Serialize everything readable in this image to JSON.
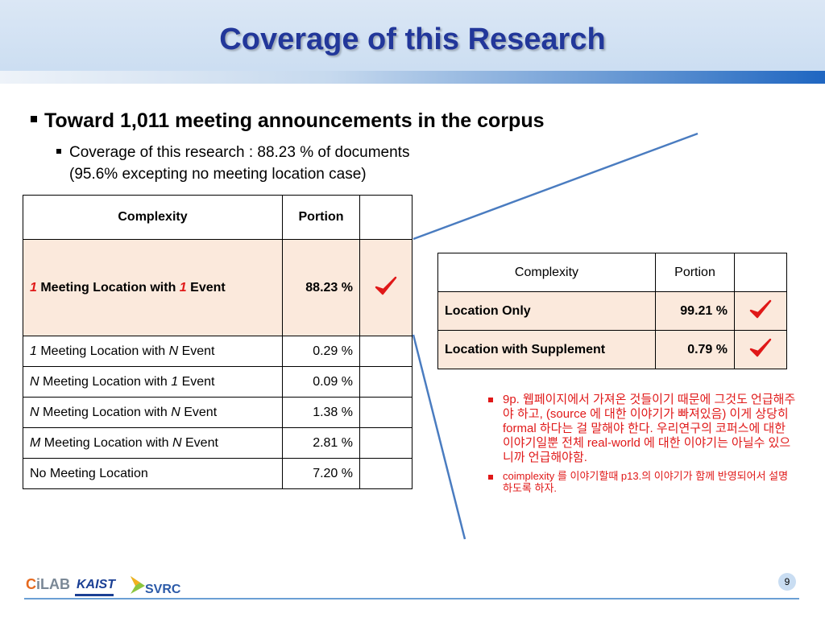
{
  "slide": {
    "title": "Coverage of this Research",
    "bullet_main": "Toward 1,011 meeting announcements in the corpus",
    "bullet_sub_line1": "Coverage of this research : 88.23 % of documents",
    "bullet_sub_line2": "(95.6% excepting no meeting location case)",
    "page_number": "9"
  },
  "table_main": {
    "headers": [
      "Complexity",
      "Portion"
    ],
    "rows": [
      {
        "pre": "1",
        "mid": " Meeting Location with ",
        "post_num": "1",
        "end": " Event",
        "value": "88.23 %",
        "checked": true
      },
      {
        "pre": "1",
        "mid": " Meeting Location with ",
        "post_num": "N",
        "end": " Event",
        "value": "0.29 %",
        "checked": false
      },
      {
        "pre": "N",
        "mid": " Meeting Location with ",
        "post_num": "1",
        "end": " Event",
        "value": "0.09 %",
        "checked": false
      },
      {
        "pre": "N",
        "mid": " Meeting Location with ",
        "post_num": "N",
        "end": " Event",
        "value": "1.38 %",
        "checked": false
      },
      {
        "pre": "M",
        "mid": " Meeting Location with ",
        "post_num": "N",
        "end": " Event",
        "value": "2.81 %",
        "checked": false
      },
      {
        "label": "No Meeting Location",
        "value": "7.20 %",
        "checked": false
      }
    ]
  },
  "table_detail": {
    "headers": [
      "Complexity",
      "Portion"
    ],
    "rows": [
      {
        "label": "Location Only",
        "value": "99.21 %",
        "checked": true
      },
      {
        "label": "Location with Supplement",
        "value": "0.79 %",
        "checked": true
      }
    ]
  },
  "notes": [
    "9p. 웹페이지에서 가져온 것들이기 때문에 그것도 언급해주야 하고, (source 에 대한 이야기가 빠져있음) 이게 상당히 formal 하다는 걸 말해야 한다. 우리연구의 코퍼스에 대한 이야기일뿐 전체 real-world 에 대한 이야기는 아닐수 있으니까 언급해야함.",
    "coimplexity 를 이야기할때 p13.의 이야기가 함께 반영되어서 설명하도록 하자."
  ],
  "logos": {
    "cilab_c": "C",
    "cilab_rest": "iLAB",
    "kaist": "KAIST",
    "svrc": "SVRC"
  },
  "colors": {
    "title": "#22379a",
    "highlight_row": "#fbe9dc",
    "check": "#e01818",
    "note_text": "#e01818",
    "connector_line": "#4a7cc0"
  },
  "icons": {
    "check": "checkmark-icon",
    "bullet": "square-bullet-icon"
  }
}
